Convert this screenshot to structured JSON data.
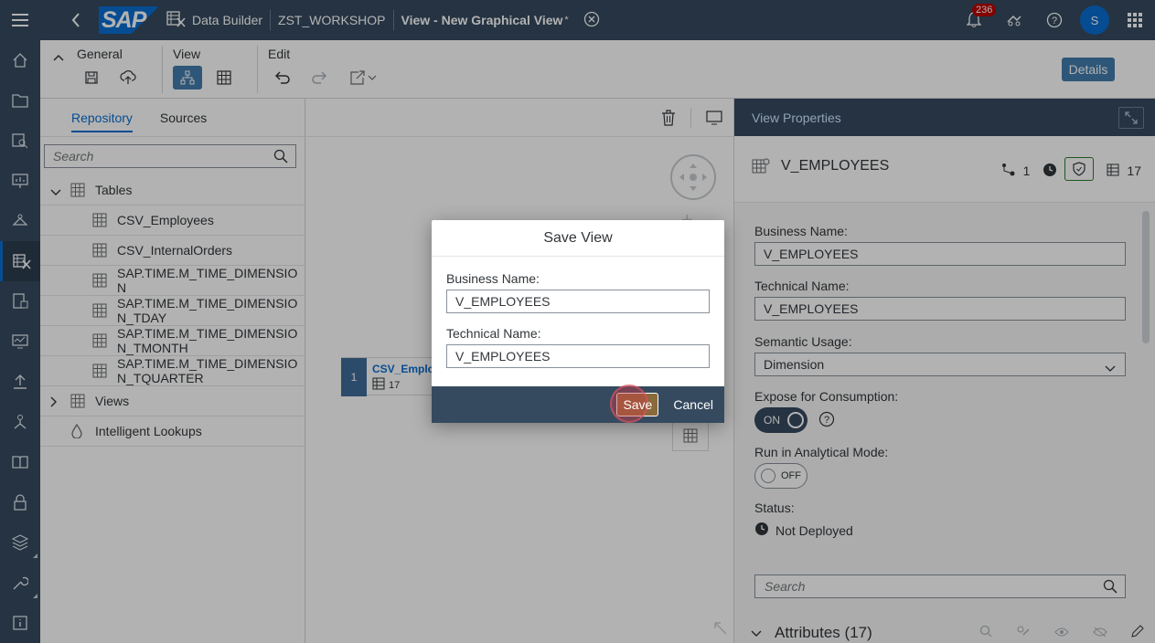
{
  "shell": {
    "app": "Data Builder",
    "space": "ZST_WORKSHOP",
    "title": "View - New Graphical View",
    "title_marker": "*",
    "notifications": "236",
    "avatar": "S"
  },
  "toolbar": {
    "general_label": "General",
    "view_label": "View",
    "edit_label": "Edit",
    "details_label": "Details"
  },
  "repository": {
    "tabs": [
      "Repository",
      "Sources"
    ],
    "search_placeholder": "Search",
    "tables_label": "Tables",
    "items": [
      {
        "line1": "CSV_Employees",
        "line2": ""
      },
      {
        "line1": "CSV_InternalOrders",
        "line2": ""
      },
      {
        "line1": "SAP.TIME.M_TIME_DIMENSIO",
        "line2": "N"
      },
      {
        "line1": "SAP.TIME.M_TIME_DIMENSIO",
        "line2": "N_TDAY"
      },
      {
        "line1": "SAP.TIME.M_TIME_DIMENSIO",
        "line2": "N_TMONTH"
      },
      {
        "line1": "SAP.TIME.M_TIME_DIMENSIO",
        "line2": "N_TQUARTER"
      }
    ],
    "views_label": "Views",
    "lookups_label": "Intelligent Lookups"
  },
  "canvas": {
    "node_num": "1",
    "node_name": "CSV_Emplo",
    "node_count": "17"
  },
  "properties": {
    "header": "View Properties",
    "object_name": "V_EMPLOYEES",
    "dependency_count": "1",
    "column_count": "17",
    "business_name_label": "Business Name:",
    "business_name": "V_EMPLOYEES",
    "technical_name_label": "Technical Name:",
    "technical_name": "V_EMPLOYEES",
    "semantic_usage_label": "Semantic Usage:",
    "semantic_usage": "Dimension",
    "expose_label": "Expose for Consumption:",
    "expose_state": "ON",
    "analytical_label": "Run in Analytical Mode:",
    "analytical_state": "OFF",
    "status_label": "Status:",
    "status": "Not Deployed",
    "search_placeholder": "Search",
    "attributes_label": "Attributes (17)"
  },
  "dialog": {
    "title": "Save View",
    "business_name_label": "Business Name:",
    "business_name": "V_EMPLOYEES",
    "technical_name_label": "Technical Name:",
    "technical_name": "V_EMPLOYEES",
    "save_label": "Save",
    "cancel_label": "Cancel"
  },
  "colors": {
    "shell": "#354a5f",
    "accent": "#0a6ed1",
    "button": "#427cac"
  }
}
